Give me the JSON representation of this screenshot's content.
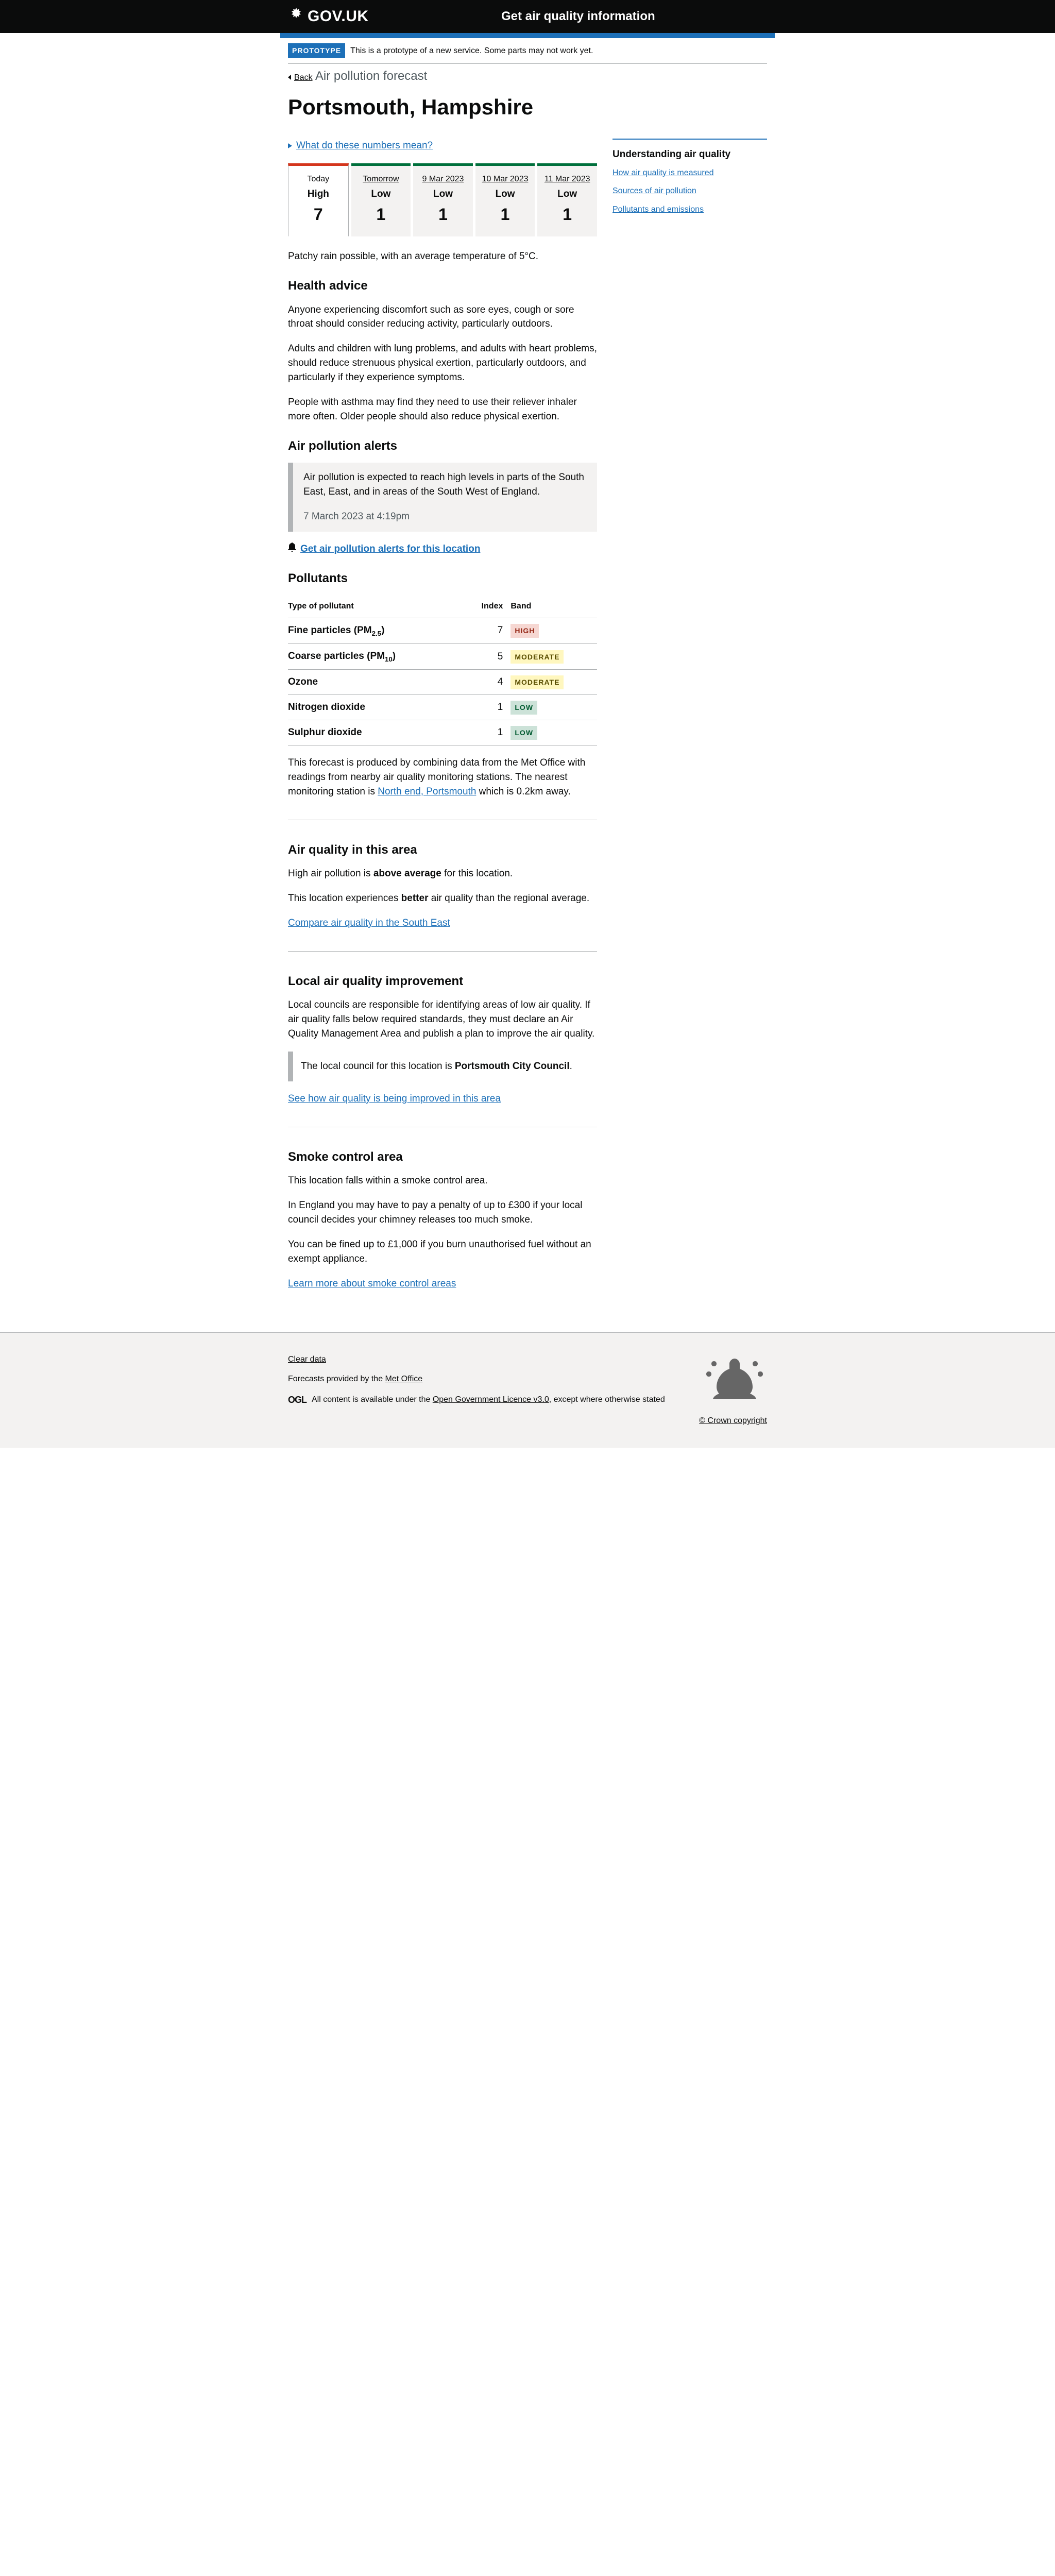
{
  "header": {
    "logo": "GOV.UK",
    "service": "Get air quality information"
  },
  "phase": {
    "tag": "PROTOTYPE",
    "text": "This is a prototype of a new service. Some parts may not work yet."
  },
  "back": "Back",
  "caption": "Air pollution forecast",
  "title": "Portsmouth, Hampshire",
  "details_summary": "What do these numbers mean?",
  "tabs": [
    {
      "day": "Today",
      "rating": "High",
      "value": "7"
    },
    {
      "day": "Tomorrow",
      "rating": "Low",
      "value": "1"
    },
    {
      "day": "9 Mar 2023",
      "rating": "Low",
      "value": "1"
    },
    {
      "day": "10 Mar 2023",
      "rating": "Low",
      "value": "1"
    },
    {
      "day": "11 Mar 2023",
      "rating": "Low",
      "value": "1"
    }
  ],
  "weather": "Patchy rain possible, with an average temperature of 5°C.",
  "health": {
    "heading": "Health advice",
    "p1": "Anyone experiencing discomfort such as sore eyes, cough or sore throat should consider reducing activity, particularly outdoors.",
    "p2": "Adults and children with lung problems, and adults with heart problems, should reduce strenuous physical exertion, particularly outdoors, and particularly if they experience symptoms.",
    "p3": "People with asthma may find they need to use their reliever inhaler more often. Older people should also reduce physical exertion."
  },
  "alerts": {
    "heading": "Air pollution alerts",
    "text": "Air pollution is expected to reach high levels in parts of the South East, East, and in areas of the South West of England.",
    "time": "7 March 2023 at 4:19pm",
    "link": "Get air pollution alerts for this location"
  },
  "pollutants": {
    "heading": "Pollutants",
    "col1": "Type of pollutant",
    "col2": "Index",
    "col3": "Band",
    "rows": [
      {
        "name": "Fine particles (PM",
        "sub": "2.5",
        "suffix": ")",
        "index": "7",
        "band": "HIGH",
        "class": "tag-high"
      },
      {
        "name": "Coarse particles (PM",
        "sub": "10",
        "suffix": ")",
        "index": "5",
        "band": "MODERATE",
        "class": "tag-moderate"
      },
      {
        "name": "Ozone",
        "sub": "",
        "suffix": "",
        "index": "4",
        "band": "MODERATE",
        "class": "tag-moderate"
      },
      {
        "name": "Nitrogen dioxide",
        "sub": "",
        "suffix": "",
        "index": "1",
        "band": "LOW",
        "class": "tag-low"
      },
      {
        "name": "Sulphur dioxide",
        "sub": "",
        "suffix": "",
        "index": "1",
        "band": "LOW",
        "class": "tag-low"
      }
    ],
    "footer_pre": "This forecast is produced by combining data from the Met Office with readings from nearby air quality monitoring stations. The nearest monitoring station is ",
    "footer_link": "North end, Portsmouth",
    "footer_post": " which is 0.2km away."
  },
  "area": {
    "heading": "Air quality in this area",
    "p1a": "High air pollution is ",
    "p1b": "above average",
    "p1c": " for this location.",
    "p2a": "This location experiences ",
    "p2b": "better",
    "p2c": " air quality than the regional average.",
    "link": "Compare air quality in the South East"
  },
  "local": {
    "heading": "Local air quality improvement",
    "p1": "Local councils are responsible for identifying areas of low air quality. If air quality falls below required standards, they must declare an Air Quality Management Area and publish a plan to improve the air quality.",
    "inset_pre": "The local council for this location is ",
    "inset_bold": "Portsmouth City Council",
    "inset_post": ".",
    "link": "See how air quality is being improved in this area"
  },
  "smoke": {
    "heading": "Smoke control area",
    "p1": "This location falls within a smoke control area.",
    "p2": "In England you may have to pay a penalty of up to £300 if your local council decides your chimney releases too much smoke.",
    "p3": "You can be fined up to £1,000 if you burn unauthorised fuel without an exempt appliance.",
    "link": "Learn more about smoke control areas"
  },
  "sidebar": {
    "heading": "Understanding air quality",
    "links": [
      "How air quality is measured",
      "Sources of air pollution",
      "Pollutants and emissions"
    ]
  },
  "footer": {
    "clear": "Clear data",
    "forecast_pre": "Forecasts provided by the ",
    "forecast_link": "Met Office",
    "ogl": "OGL",
    "licence_pre": "All content is available under the ",
    "licence_link": "Open Government Licence v3.0",
    "licence_post": ", except where otherwise stated",
    "copyright": "© Crown copyright"
  }
}
